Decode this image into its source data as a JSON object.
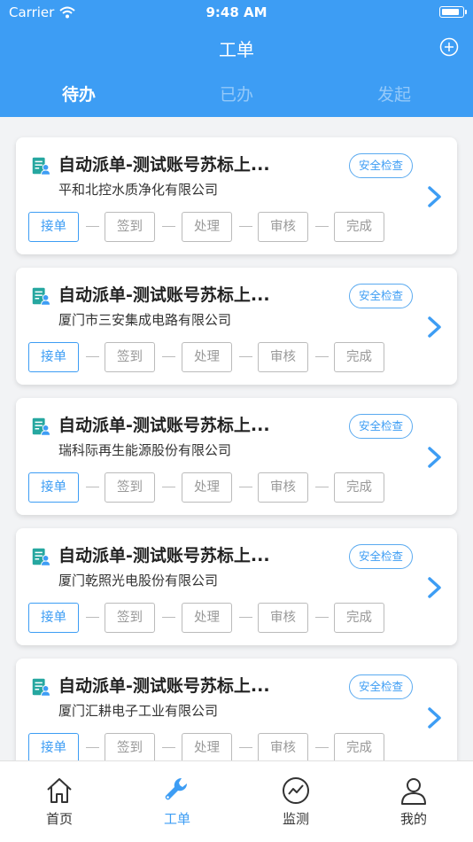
{
  "status_bar": {
    "carrier": "Carrier",
    "time": "9:48 AM",
    "battery_level": 0.9
  },
  "header": {
    "title": "工单"
  },
  "tabs": [
    {
      "label": "待办",
      "active": true
    },
    {
      "label": "已办",
      "active": false
    },
    {
      "label": "发起",
      "active": false
    }
  ],
  "cards": [
    {
      "title": "自动派单-测试账号苏标上...",
      "company": "平和北控水质净化有限公司",
      "badge": "安全检查"
    },
    {
      "title": "自动派单-测试账号苏标上...",
      "company": "厦门市三安集成电路有限公司",
      "badge": "安全检查"
    },
    {
      "title": "自动派单-测试账号苏标上...",
      "company": "瑞科际再生能源股份有限公司",
      "badge": "安全检查"
    },
    {
      "title": "自动派单-测试账号苏标上...",
      "company": "厦门乾照光电股份有限公司",
      "badge": "安全检查"
    },
    {
      "title": "自动派单-测试账号苏标上...",
      "company": "厦门汇耕电子工业有限公司",
      "badge": "安全检查"
    }
  ],
  "steps": [
    "接单",
    "签到",
    "处理",
    "审核",
    "完成"
  ],
  "bottom_nav": [
    {
      "label": "首页",
      "icon": "home-icon",
      "active": false
    },
    {
      "label": "工单",
      "icon": "wrench-icon",
      "active": true
    },
    {
      "label": "监测",
      "icon": "monitor-icon",
      "active": false
    },
    {
      "label": "我的",
      "icon": "profile-icon",
      "active": false
    }
  ],
  "colors": {
    "accent": "#3d9df4",
    "header_bg": "#3d9df4",
    "page_bg": "#f2f3f5"
  }
}
